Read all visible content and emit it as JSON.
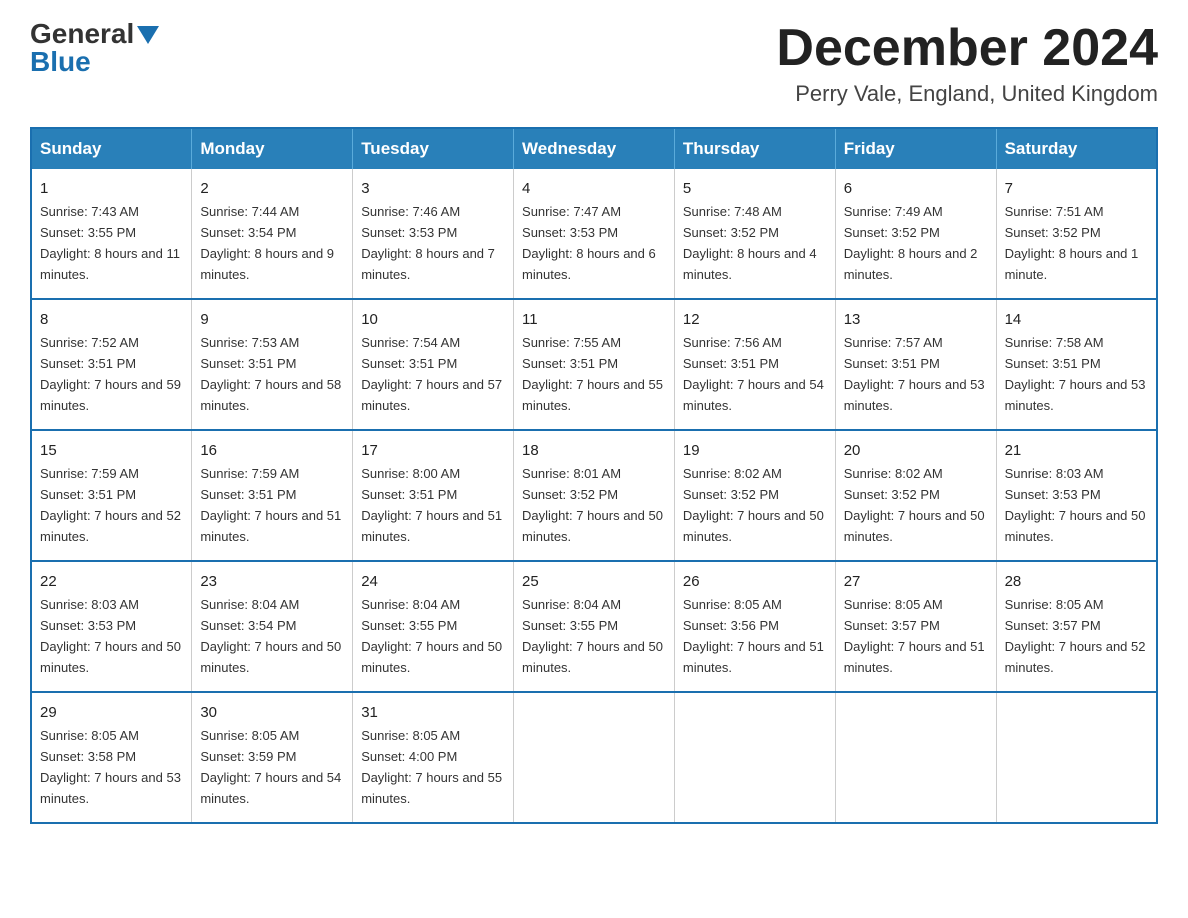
{
  "header": {
    "logo_general": "General",
    "logo_blue": "Blue",
    "month_title": "December 2024",
    "location": "Perry Vale, England, United Kingdom"
  },
  "days_of_week": [
    "Sunday",
    "Monday",
    "Tuesday",
    "Wednesday",
    "Thursday",
    "Friday",
    "Saturday"
  ],
  "weeks": [
    [
      {
        "day": "1",
        "sunrise": "Sunrise: 7:43 AM",
        "sunset": "Sunset: 3:55 PM",
        "daylight": "Daylight: 8 hours and 11 minutes."
      },
      {
        "day": "2",
        "sunrise": "Sunrise: 7:44 AM",
        "sunset": "Sunset: 3:54 PM",
        "daylight": "Daylight: 8 hours and 9 minutes."
      },
      {
        "day": "3",
        "sunrise": "Sunrise: 7:46 AM",
        "sunset": "Sunset: 3:53 PM",
        "daylight": "Daylight: 8 hours and 7 minutes."
      },
      {
        "day": "4",
        "sunrise": "Sunrise: 7:47 AM",
        "sunset": "Sunset: 3:53 PM",
        "daylight": "Daylight: 8 hours and 6 minutes."
      },
      {
        "day": "5",
        "sunrise": "Sunrise: 7:48 AM",
        "sunset": "Sunset: 3:52 PM",
        "daylight": "Daylight: 8 hours and 4 minutes."
      },
      {
        "day": "6",
        "sunrise": "Sunrise: 7:49 AM",
        "sunset": "Sunset: 3:52 PM",
        "daylight": "Daylight: 8 hours and 2 minutes."
      },
      {
        "day": "7",
        "sunrise": "Sunrise: 7:51 AM",
        "sunset": "Sunset: 3:52 PM",
        "daylight": "Daylight: 8 hours and 1 minute."
      }
    ],
    [
      {
        "day": "8",
        "sunrise": "Sunrise: 7:52 AM",
        "sunset": "Sunset: 3:51 PM",
        "daylight": "Daylight: 7 hours and 59 minutes."
      },
      {
        "day": "9",
        "sunrise": "Sunrise: 7:53 AM",
        "sunset": "Sunset: 3:51 PM",
        "daylight": "Daylight: 7 hours and 58 minutes."
      },
      {
        "day": "10",
        "sunrise": "Sunrise: 7:54 AM",
        "sunset": "Sunset: 3:51 PM",
        "daylight": "Daylight: 7 hours and 57 minutes."
      },
      {
        "day": "11",
        "sunrise": "Sunrise: 7:55 AM",
        "sunset": "Sunset: 3:51 PM",
        "daylight": "Daylight: 7 hours and 55 minutes."
      },
      {
        "day": "12",
        "sunrise": "Sunrise: 7:56 AM",
        "sunset": "Sunset: 3:51 PM",
        "daylight": "Daylight: 7 hours and 54 minutes."
      },
      {
        "day": "13",
        "sunrise": "Sunrise: 7:57 AM",
        "sunset": "Sunset: 3:51 PM",
        "daylight": "Daylight: 7 hours and 53 minutes."
      },
      {
        "day": "14",
        "sunrise": "Sunrise: 7:58 AM",
        "sunset": "Sunset: 3:51 PM",
        "daylight": "Daylight: 7 hours and 53 minutes."
      }
    ],
    [
      {
        "day": "15",
        "sunrise": "Sunrise: 7:59 AM",
        "sunset": "Sunset: 3:51 PM",
        "daylight": "Daylight: 7 hours and 52 minutes."
      },
      {
        "day": "16",
        "sunrise": "Sunrise: 7:59 AM",
        "sunset": "Sunset: 3:51 PM",
        "daylight": "Daylight: 7 hours and 51 minutes."
      },
      {
        "day": "17",
        "sunrise": "Sunrise: 8:00 AM",
        "sunset": "Sunset: 3:51 PM",
        "daylight": "Daylight: 7 hours and 51 minutes."
      },
      {
        "day": "18",
        "sunrise": "Sunrise: 8:01 AM",
        "sunset": "Sunset: 3:52 PM",
        "daylight": "Daylight: 7 hours and 50 minutes."
      },
      {
        "day": "19",
        "sunrise": "Sunrise: 8:02 AM",
        "sunset": "Sunset: 3:52 PM",
        "daylight": "Daylight: 7 hours and 50 minutes."
      },
      {
        "day": "20",
        "sunrise": "Sunrise: 8:02 AM",
        "sunset": "Sunset: 3:52 PM",
        "daylight": "Daylight: 7 hours and 50 minutes."
      },
      {
        "day": "21",
        "sunrise": "Sunrise: 8:03 AM",
        "sunset": "Sunset: 3:53 PM",
        "daylight": "Daylight: 7 hours and 50 minutes."
      }
    ],
    [
      {
        "day": "22",
        "sunrise": "Sunrise: 8:03 AM",
        "sunset": "Sunset: 3:53 PM",
        "daylight": "Daylight: 7 hours and 50 minutes."
      },
      {
        "day": "23",
        "sunrise": "Sunrise: 8:04 AM",
        "sunset": "Sunset: 3:54 PM",
        "daylight": "Daylight: 7 hours and 50 minutes."
      },
      {
        "day": "24",
        "sunrise": "Sunrise: 8:04 AM",
        "sunset": "Sunset: 3:55 PM",
        "daylight": "Daylight: 7 hours and 50 minutes."
      },
      {
        "day": "25",
        "sunrise": "Sunrise: 8:04 AM",
        "sunset": "Sunset: 3:55 PM",
        "daylight": "Daylight: 7 hours and 50 minutes."
      },
      {
        "day": "26",
        "sunrise": "Sunrise: 8:05 AM",
        "sunset": "Sunset: 3:56 PM",
        "daylight": "Daylight: 7 hours and 51 minutes."
      },
      {
        "day": "27",
        "sunrise": "Sunrise: 8:05 AM",
        "sunset": "Sunset: 3:57 PM",
        "daylight": "Daylight: 7 hours and 51 minutes."
      },
      {
        "day": "28",
        "sunrise": "Sunrise: 8:05 AM",
        "sunset": "Sunset: 3:57 PM",
        "daylight": "Daylight: 7 hours and 52 minutes."
      }
    ],
    [
      {
        "day": "29",
        "sunrise": "Sunrise: 8:05 AM",
        "sunset": "Sunset: 3:58 PM",
        "daylight": "Daylight: 7 hours and 53 minutes."
      },
      {
        "day": "30",
        "sunrise": "Sunrise: 8:05 AM",
        "sunset": "Sunset: 3:59 PM",
        "daylight": "Daylight: 7 hours and 54 minutes."
      },
      {
        "day": "31",
        "sunrise": "Sunrise: 8:05 AM",
        "sunset": "Sunset: 4:00 PM",
        "daylight": "Daylight: 7 hours and 55 minutes."
      },
      {
        "day": "",
        "sunrise": "",
        "sunset": "",
        "daylight": ""
      },
      {
        "day": "",
        "sunrise": "",
        "sunset": "",
        "daylight": ""
      },
      {
        "day": "",
        "sunrise": "",
        "sunset": "",
        "daylight": ""
      },
      {
        "day": "",
        "sunrise": "",
        "sunset": "",
        "daylight": ""
      }
    ]
  ]
}
